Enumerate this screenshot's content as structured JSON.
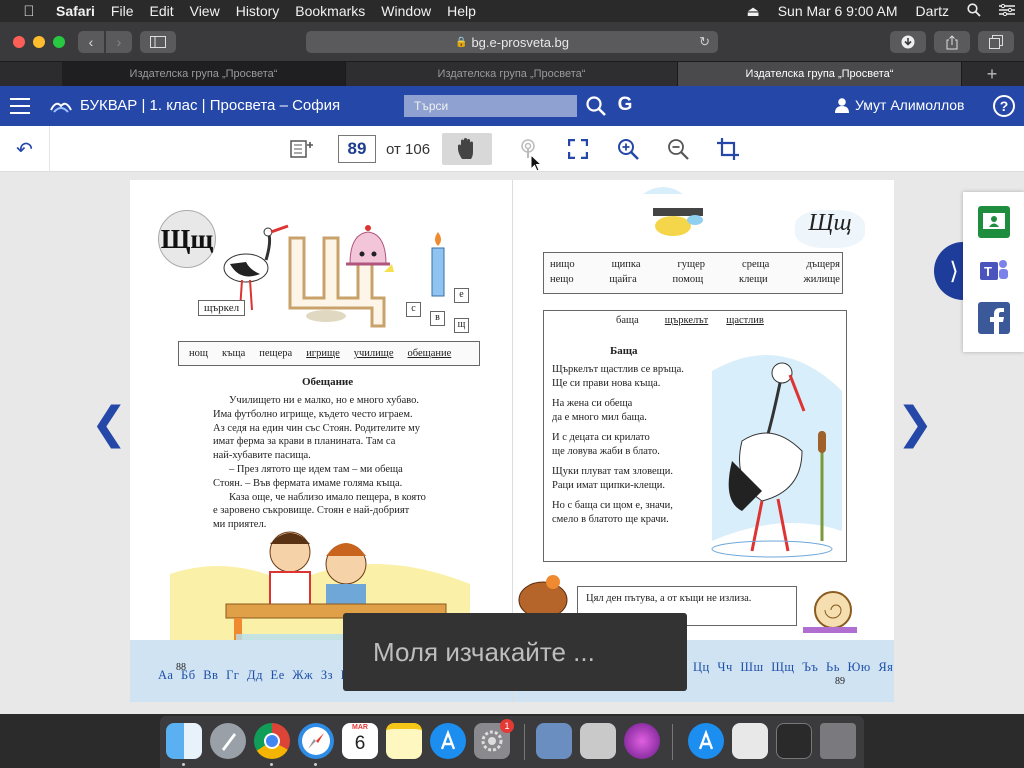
{
  "menubar": {
    "app_name": "Safari",
    "items": [
      "File",
      "Edit",
      "View",
      "History",
      "Bookmarks",
      "Window",
      "Help"
    ],
    "datetime": "Sun Mar 6  9:00 AM",
    "user": "Dartz"
  },
  "browser": {
    "url": "bg.e-prosveta.bg",
    "tabs": [
      "Издателска група „Просвета“",
      "Издателска група „Просвета“",
      "Издателска група „Просвета“"
    ],
    "new_tab": "+"
  },
  "app": {
    "title": "БУКВАР | 1. клас | Просвета – София",
    "search_placeholder": "Търси",
    "google_label": "G",
    "user_name": "Умут Алимоллов",
    "help_label": "?"
  },
  "viewer": {
    "page_number": "89",
    "page_total_label": "от 106"
  },
  "book": {
    "left": {
      "letter": "Щщ",
      "stork_label": "щъркел",
      "letter_tiles": [
        "с",
        "в",
        "е",
        "щ"
      ],
      "words": [
        "нощ",
        "къща",
        "пещера",
        "игрище",
        "училище",
        "обещание"
      ],
      "story_title": "Обещание",
      "story_lines": [
        "Училището ни е малко, но е много хубаво.",
        "Има футболно игрище, където често играем.",
        "Аз седя на един чин със Стоян. Родителите му",
        "имат ферма за крави в планината. Там са",
        "най-хубавите пасища.",
        "– През лятото ще идем там – ми обеща",
        "Стоян. – Във фермата имаме голяма къща.",
        "Каза още, че наблизо имало пещера, в която",
        "е заровено съкровище. Стоян е най-добрият",
        "ми приятел."
      ],
      "page_num": "88",
      "alphabet": "Аа Бб Вв Гг Дд Ее Жж Зз Ии"
    },
    "right": {
      "script_letter": "Щщ",
      "word_grid": [
        [
          "нищо",
          "щипка",
          "гущер",
          "среща",
          "дъщеря"
        ],
        [
          "нещо",
          "щайга",
          "помощ",
          "клещи",
          "жилище"
        ]
      ],
      "phrase_words": [
        "баща",
        "щъркелът",
        "щастлив"
      ],
      "poem_title": "Баща",
      "poem_stanzas": [
        [
          "Щъркелът щастлив се връща.",
          "Ще си прави нова къща."
        ],
        [
          "На жена си обеща",
          "да е много мил баща."
        ],
        [
          "И с децата си крилато",
          "ще ловува жаби в блато."
        ],
        [
          "Щуки плуват там зловещи.",
          "Раци имат щипки-клещи."
        ],
        [
          "Но с баща си щом е, значи,",
          "смело в блатото ще крачи."
        ]
      ],
      "riddle": "Цял ден пътува, а от къщи не излиза.",
      "page_num": "89",
      "alphabet": "Цц Чч Шш Щщ Ъъ Ьь Юю Яя"
    }
  },
  "toast": "Моля изчакайте ...",
  "dock": {
    "badge_count": "1",
    "calendar_month": "MAR",
    "calendar_day": "6"
  },
  "colors": {
    "brand_blue": "#2447a8",
    "side_tab_blue": "#1e3d9a",
    "toast_bg": "#333333"
  }
}
